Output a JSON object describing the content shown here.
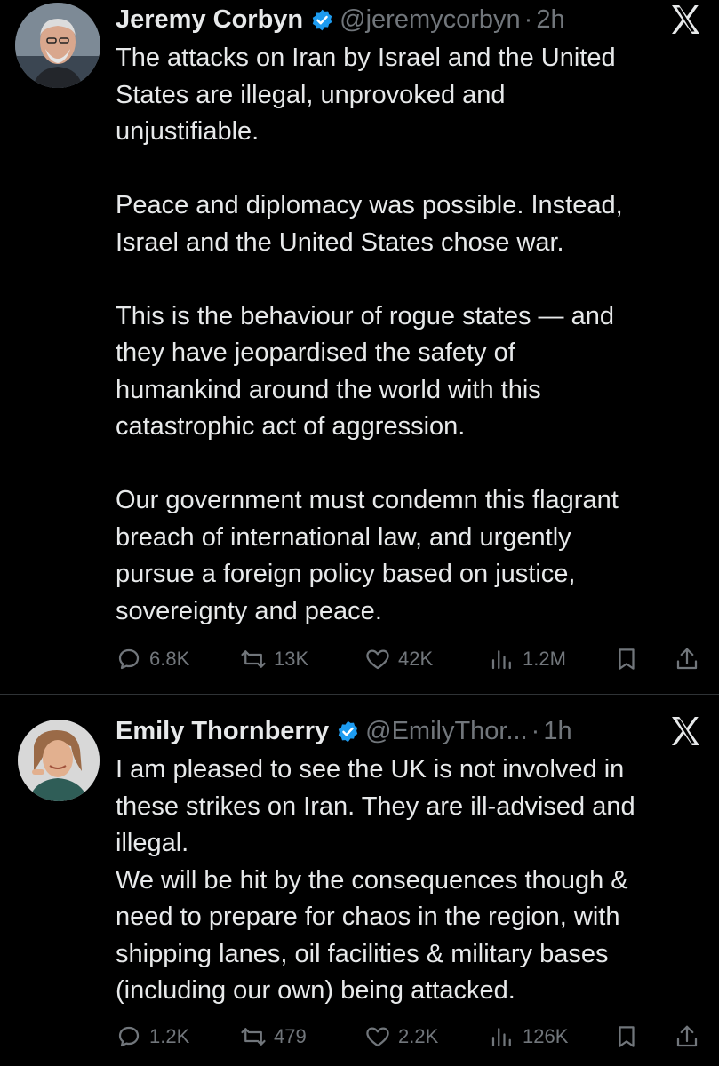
{
  "tweets": [
    {
      "author_name": "Jeremy Corbyn",
      "handle": "@jeremycorbyn",
      "separator": "·",
      "time": "2h",
      "paragraphs": [
        [
          "The attacks on Iran by Israel and the United",
          "States are illegal, unprovoked and",
          "unjustifiable."
        ],
        [
          "Peace and diplomacy was possible. Instead,",
          "Israel and the United States chose war."
        ],
        [
          "This is the behaviour of rogue states — and",
          "they have jeopardised the safety of",
          "humankind around the world with this",
          "catastrophic act of aggression."
        ],
        [
          "Our government must condemn this flagrant",
          "breach of international law, and urgently",
          "pursue a foreign policy based on justice,",
          "sovereignty and peace."
        ]
      ],
      "stats": {
        "replies": "6.8K",
        "reposts": "13K",
        "likes": "42K",
        "views": "1.2M"
      }
    },
    {
      "author_name": "Emily Thornberry",
      "handle": "@EmilyThor...",
      "separator": "·",
      "time": "1h",
      "paragraphs": [
        [
          "I am pleased to see the UK is not involved in",
          "these strikes on Iran. They are ill-advised and",
          "illegal.",
          "We will be hit by the consequences though &",
          "need to prepare for chaos in the region, with",
          "shipping lanes, oil facilities & military bases",
          "(including our own) being attacked."
        ]
      ],
      "stats": {
        "replies": "1.2K",
        "reposts": "479",
        "likes": "2.2K",
        "views": "126K"
      }
    }
  ],
  "icons": {
    "verified": "verified-badge-icon",
    "platform": "x-logo-icon",
    "reply": "reply-icon",
    "repost": "repost-icon",
    "like": "heart-icon",
    "views": "views-icon",
    "bookmark": "bookmark-icon",
    "share": "share-icon"
  },
  "colors": {
    "background": "#000000",
    "text": "#e7e9ea",
    "muted": "#71767b",
    "verified": "#1d9bf0",
    "divider": "#2f3336"
  }
}
